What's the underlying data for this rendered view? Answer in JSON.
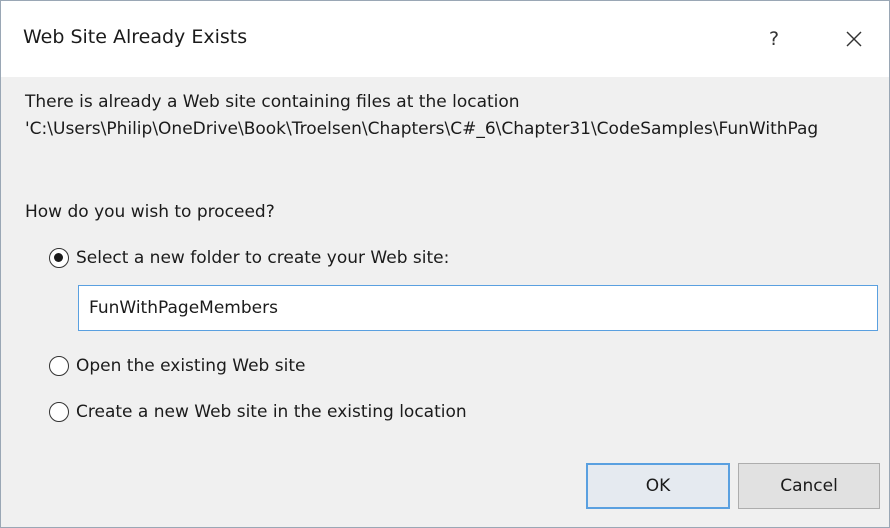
{
  "dialog": {
    "title": "Web Site Already Exists",
    "help_label": "?",
    "close_icon": "close-icon",
    "message_line1": "There is already a Web site containing files at the location",
    "message_line2": "'C:\\Users\\Philip\\OneDrive\\Book\\Troelsen\\Chapters\\C#_6\\Chapter31\\CodeSamples\\FunWithPag",
    "question": "How do you wish to proceed?",
    "options": [
      {
        "label": "Select a new folder to create your Web site:",
        "selected": true
      },
      {
        "label": "Open the existing Web site",
        "selected": false
      },
      {
        "label": "Create a new Web site in the existing location",
        "selected": false
      }
    ],
    "folder_input": {
      "value": "FunWithPageMembers"
    },
    "ok_label": "OK",
    "cancel_label": "Cancel",
    "colors": {
      "accent": "#5aa0e0",
      "dialog_bg": "#f0f0f0",
      "titlebar_bg": "#ffffff"
    }
  }
}
